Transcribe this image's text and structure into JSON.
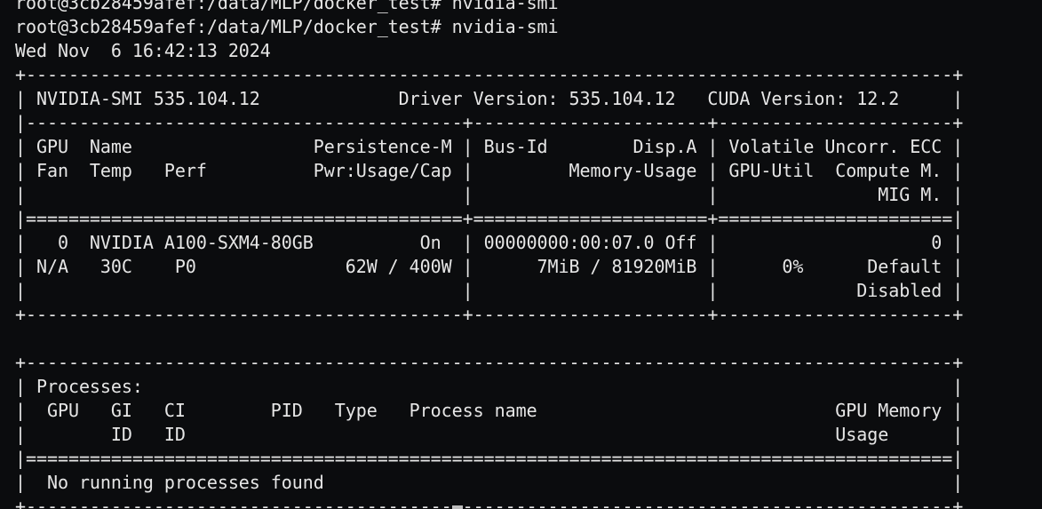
{
  "terminal": {
    "lines": [
      "root@3cb28459afef:/data/MLP/docker_test# nvidia-smi",
      "root@3cb28459afef:/data/MLP/docker_test# nvidia-smi",
      "Wed Nov  6 16:42:13 2024",
      "+---------------------------------------------------------------------------------------+",
      "| NVIDIA-SMI 535.104.12             Driver Version: 535.104.12   CUDA Version: 12.2     |",
      "|-----------------------------------------+----------------------+----------------------+",
      "| GPU  Name                 Persistence-M | Bus-Id        Disp.A | Volatile Uncorr. ECC |",
      "| Fan  Temp   Perf          Pwr:Usage/Cap |         Memory-Usage | GPU-Util  Compute M. |",
      "|                                         |                      |               MIG M. |",
      "|=========================================+======================+======================|",
      "|   0  NVIDIA A100-SXM4-80GB          On  | 00000000:00:07.0 Off |                    0 |",
      "| N/A   30C    P0              62W / 400W |      7MiB / 81920MiB |      0%      Default |",
      "|                                         |                      |             Disabled |",
      "+-----------------------------------------+----------------------+----------------------+",
      "",
      "+---------------------------------------------------------------------------------------+",
      "| Processes:                                                                            |",
      "|  GPU   GI   CI        PID   Type   Process name                            GPU Memory |",
      "|        ID   ID                                                             Usage      |",
      "|=======================================================================================|",
      "|  No running processes found                                                           |",
      "+---------------------------------------------------------------------------------------+"
    ]
  }
}
